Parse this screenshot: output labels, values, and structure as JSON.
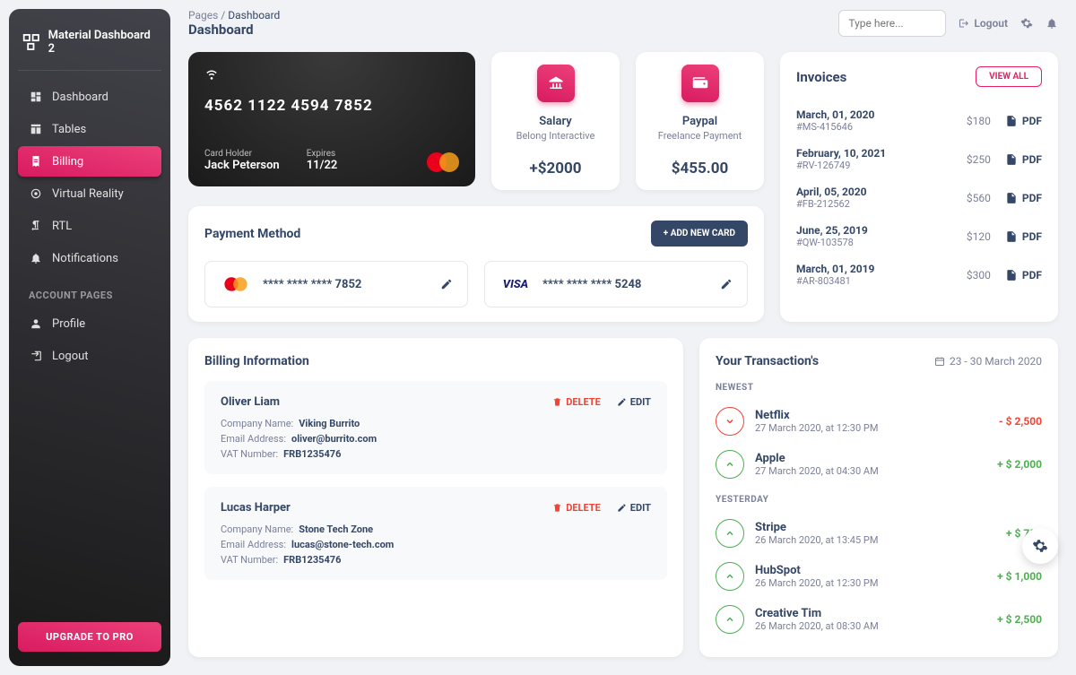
{
  "brand": "Material Dashboard 2",
  "sidebar": {
    "items": [
      {
        "label": "Dashboard",
        "icon": "dashboard"
      },
      {
        "label": "Tables",
        "icon": "table"
      },
      {
        "label": "Billing",
        "icon": "receipt",
        "active": true
      },
      {
        "label": "Virtual Reality",
        "icon": "vr"
      },
      {
        "label": "RTL",
        "icon": "rtl"
      },
      {
        "label": "Notifications",
        "icon": "bell"
      }
    ],
    "section_title": "ACCOUNT PAGES",
    "account_items": [
      {
        "label": "Profile",
        "icon": "user"
      },
      {
        "label": "Logout",
        "icon": "logout"
      }
    ],
    "upgrade": "UPGRADE TO PRO"
  },
  "topbar": {
    "breadcrumb_parent": "Pages",
    "breadcrumb_current": "Dashboard",
    "page_title": "Dashboard",
    "search_placeholder": "Type here...",
    "logout": "Logout"
  },
  "credit_card": {
    "number": "4562   1122   4594   7852",
    "holder_label": "Card Holder",
    "holder": "Jack Peterson",
    "exp_label": "Expires",
    "exp": "11/22"
  },
  "stats": [
    {
      "title": "Salary",
      "sub": "Belong Interactive",
      "amount": "+$2000",
      "icon": "bank"
    },
    {
      "title": "Paypal",
      "sub": "Freelance Payment",
      "amount": "$455.00",
      "icon": "wallet"
    }
  ],
  "invoices": {
    "title": "Invoices",
    "view_all": "VIEW ALL",
    "pdf_label": "PDF",
    "items": [
      {
        "date": "March, 01, 2020",
        "id": "#MS-415646",
        "amount": "$180"
      },
      {
        "date": "February, 10, 2021",
        "id": "#RV-126749",
        "amount": "$250"
      },
      {
        "date": "April, 05, 2020",
        "id": "#FB-212562",
        "amount": "$560"
      },
      {
        "date": "June, 25, 2019",
        "id": "#QW-103578",
        "amount": "$120"
      },
      {
        "date": "March, 01, 2019",
        "id": "#AR-803481",
        "amount": "$300"
      }
    ]
  },
  "payment": {
    "title": "Payment Method",
    "add_card": "+   ADD NEW CARD",
    "cards": [
      {
        "brand": "mastercard",
        "number": "****   ****   ****   7852"
      },
      {
        "brand": "visa",
        "number": "****   ****   ****   5248"
      }
    ]
  },
  "billing": {
    "title": "Billing Information",
    "company_label": "Company Name:",
    "email_label": "Email Address:",
    "vat_label": "VAT Number:",
    "delete": "DELETE",
    "edit": "EDIT",
    "items": [
      {
        "name": "Oliver Liam",
        "company": "Viking Burrito",
        "email": "oliver@burrito.com",
        "vat": "FRB1235476"
      },
      {
        "name": "Lucas Harper",
        "company": "Stone Tech Zone",
        "email": "lucas@stone-tech.com",
        "vat": "FRB1235476"
      }
    ]
  },
  "transactions": {
    "title": "Your Transaction's",
    "range": "23 - 30 March 2020",
    "newest": "NEWEST",
    "yesterday": "YESTERDAY",
    "newest_items": [
      {
        "name": "Netflix",
        "time": "27 March 2020, at 12:30 PM",
        "amount": "- $ 2,500",
        "dir": "down"
      },
      {
        "name": "Apple",
        "time": "27 March 2020, at 04:30 AM",
        "amount": "+ $ 2,000",
        "dir": "up"
      }
    ],
    "yesterday_items": [
      {
        "name": "Stripe",
        "time": "26 March 2020, at 13:45 PM",
        "amount": "+ $ 750",
        "dir": "up"
      },
      {
        "name": "HubSpot",
        "time": "26 March 2020, at 12:30 PM",
        "amount": "+ $ 1,000",
        "dir": "up"
      },
      {
        "name": "Creative Tim",
        "time": "26 March 2020, at 08:30 AM",
        "amount": "+ $ 2,500",
        "dir": "up"
      }
    ]
  }
}
